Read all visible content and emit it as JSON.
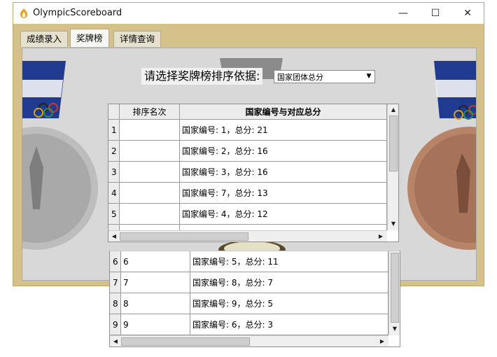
{
  "window": {
    "title": "OlympicScoreboard",
    "controls": {
      "minimize": "—",
      "maximize": "☐",
      "close": "✕"
    }
  },
  "tabs": [
    {
      "label": "成绩录入"
    },
    {
      "label": "奖牌榜"
    },
    {
      "label": "详情查询"
    }
  ],
  "sort": {
    "label": "请选择奖牌榜排序依据:",
    "selected": "国家团体总分"
  },
  "upper_table": {
    "headers": [
      "排序名次",
      "国家编号与对应总分"
    ],
    "rows": [
      {
        "num": "1",
        "rank": "",
        "info": "国家编号: 1，总分: 21"
      },
      {
        "num": "2",
        "rank": "",
        "info": "国家编号: 2，总分: 16"
      },
      {
        "num": "3",
        "rank": "",
        "info": "国家编号: 3，总分: 16"
      },
      {
        "num": "4",
        "rank": "",
        "info": "国家编号: 7，总分: 13"
      },
      {
        "num": "5",
        "rank": "",
        "info": "国家编号: 4，总分: 12"
      }
    ]
  },
  "lower_table": {
    "rows": [
      {
        "num": "6",
        "rank": "6",
        "info": "国家编号: 5，总分: 11"
      },
      {
        "num": "7",
        "rank": "7",
        "info": "国家编号: 8，总分: 7"
      },
      {
        "num": "8",
        "rank": "8",
        "info": "国家编号: 9，总分: 5"
      },
      {
        "num": "9",
        "rank": "9",
        "info": "国家编号: 6，总分: 3"
      }
    ]
  },
  "colors": {
    "frame": "#d5c28a",
    "panel": "#d8d8d8",
    "silver": "#bdbdbd",
    "bronze": "#b88468",
    "ribbon_blue": "#1f3a8f"
  }
}
